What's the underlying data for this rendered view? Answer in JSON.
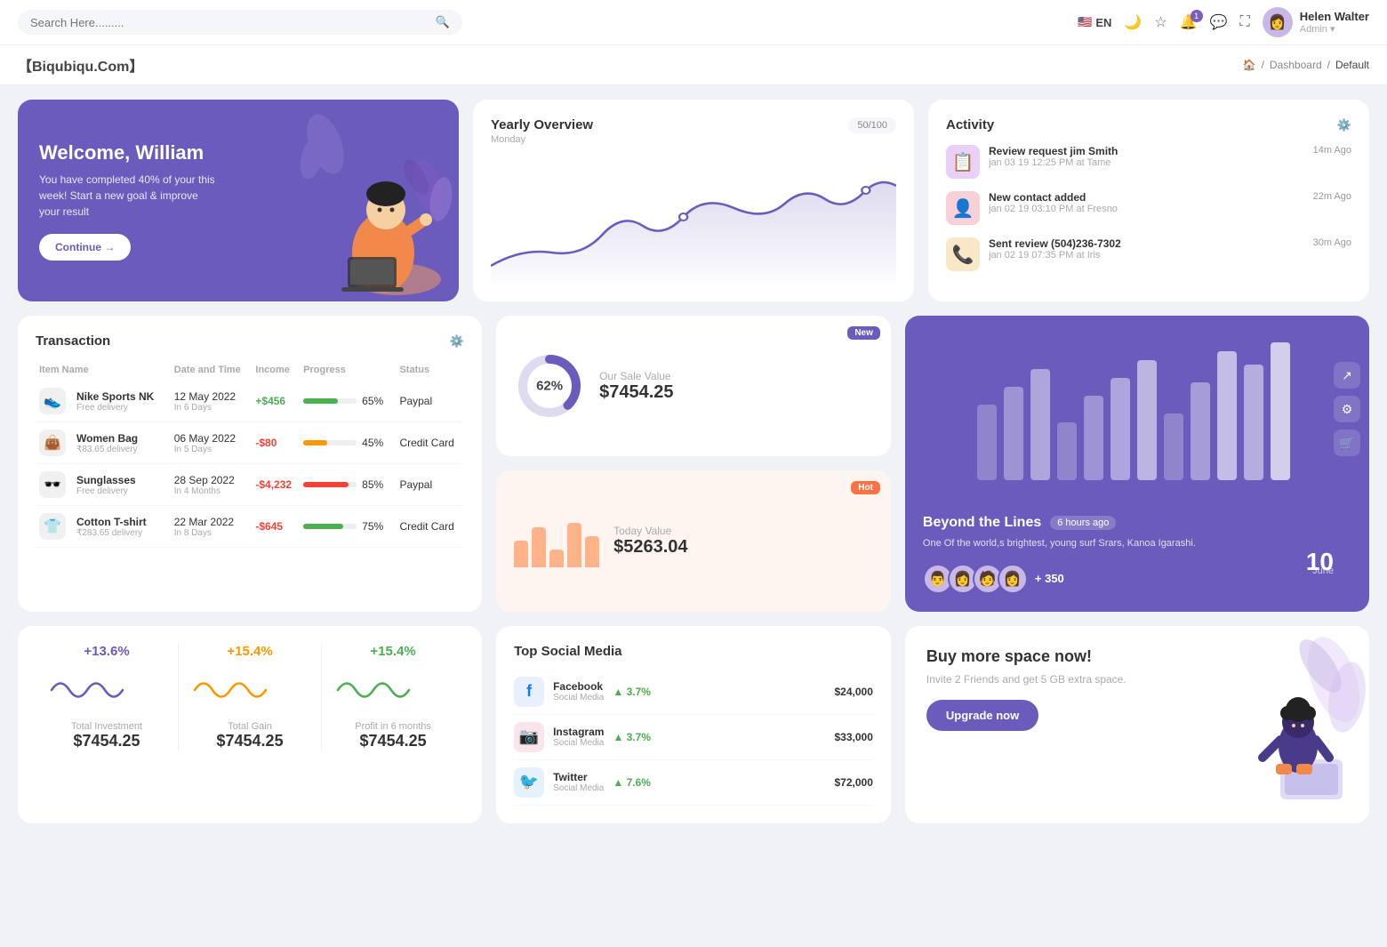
{
  "header": {
    "search_placeholder": "Search Here.........",
    "lang": "EN",
    "user": {
      "name": "Helen Walter",
      "role": "Admin"
    },
    "bell_count": "1"
  },
  "breadcrumb": {
    "brand": "【Biqubiqu.Com】",
    "items": [
      "Home",
      "Dashboard",
      "Default"
    ]
  },
  "welcome": {
    "title": "Welcome, William",
    "body": "You have completed 40% of your this week! Start a new goal & improve your result",
    "button": "Continue →"
  },
  "yearly": {
    "title": "Yearly Overview",
    "subtitle": "Monday",
    "badge": "50/100"
  },
  "activity": {
    "title": "Activity",
    "items": [
      {
        "title": "Review request jim Smith",
        "sub": "jan 03 19 12:25 PM at Tame",
        "time": "14m Ago"
      },
      {
        "title": "New contact added",
        "sub": "jan 02 19 03:10 PM at Fresno",
        "time": "22m Ago"
      },
      {
        "title": "Sent review (504)236-7302",
        "sub": "jan 02 19 07:35 PM at Iris",
        "time": "30m Ago"
      }
    ]
  },
  "transaction": {
    "title": "Transaction",
    "columns": [
      "Item Name",
      "Date and Time",
      "Income",
      "Progress",
      "Status"
    ],
    "rows": [
      {
        "name": "Nike Sports NK",
        "sub": "Free delivery",
        "date": "12 May 2022",
        "time": "In 6 Days",
        "income": "+$456",
        "income_type": "pos",
        "progress": 65,
        "progress_type": "green",
        "status": "Paypal",
        "icon": "👟"
      },
      {
        "name": "Women Bag",
        "sub": "₹83.65 delivery",
        "date": "06 May 2022",
        "time": "In 5 Days",
        "income": "-$80",
        "income_type": "neg",
        "progress": 45,
        "progress_type": "orange",
        "status": "Credit Card",
        "icon": "👜"
      },
      {
        "name": "Sunglasses",
        "sub": "Free delivery",
        "date": "28 Sep 2022",
        "time": "In 4 Months",
        "income": "-$4,232",
        "income_type": "neg",
        "progress": 85,
        "progress_type": "red",
        "status": "Paypal",
        "icon": "🕶️"
      },
      {
        "name": "Cotton T-shirt",
        "sub": "₹283.65 delivery",
        "date": "22 Mar 2022",
        "time": "In 8 Days",
        "income": "-$645",
        "income_type": "neg",
        "progress": 75,
        "progress_type": "green",
        "status": "Credit Card",
        "icon": "👕"
      }
    ]
  },
  "sale_value": {
    "donut_pct": "62%",
    "label": "Our Sale Value",
    "value": "$7454.25",
    "badge": "New"
  },
  "today_value": {
    "label": "Today Value",
    "value": "$5263.04",
    "badge": "Hot"
  },
  "beyond": {
    "title": "Beyond the Lines",
    "time_ago": "6 hours ago",
    "desc": "One Of the world,s brightest, young surf Srars, Kanoa Igarashi.",
    "plus": "+ 350",
    "date_day": "10",
    "date_month": "June"
  },
  "stats": [
    {
      "pct": "+13.6%",
      "label": "Total Investment",
      "value": "$7454.25",
      "color": "#6b5bbd"
    },
    {
      "pct": "+15.4%",
      "label": "Total Gain",
      "value": "$7454.25",
      "color": "#ff9800"
    },
    {
      "pct": "+15.4%",
      "label": "Profit in 6 months",
      "value": "$7454.25",
      "color": "#4caf50"
    }
  ],
  "social": {
    "title": "Top Social Media",
    "items": [
      {
        "name": "Facebook",
        "sub": "Social Media",
        "pct": "3.7%",
        "value": "$24,000",
        "icon": "f",
        "color": "fb"
      },
      {
        "name": "Instagram",
        "sub": "Social Media",
        "pct": "3.7%",
        "value": "$33,000",
        "icon": "📷",
        "color": "ig"
      },
      {
        "name": "Twitter",
        "sub": "Social Media",
        "pct": "7.6%",
        "value": "$72,000",
        "icon": "🐦",
        "color": "tw"
      }
    ]
  },
  "buy_space": {
    "title": "Buy more space now!",
    "desc": "Invite 2 Friends and get 5 GB extra space.",
    "button": "Upgrade now"
  }
}
